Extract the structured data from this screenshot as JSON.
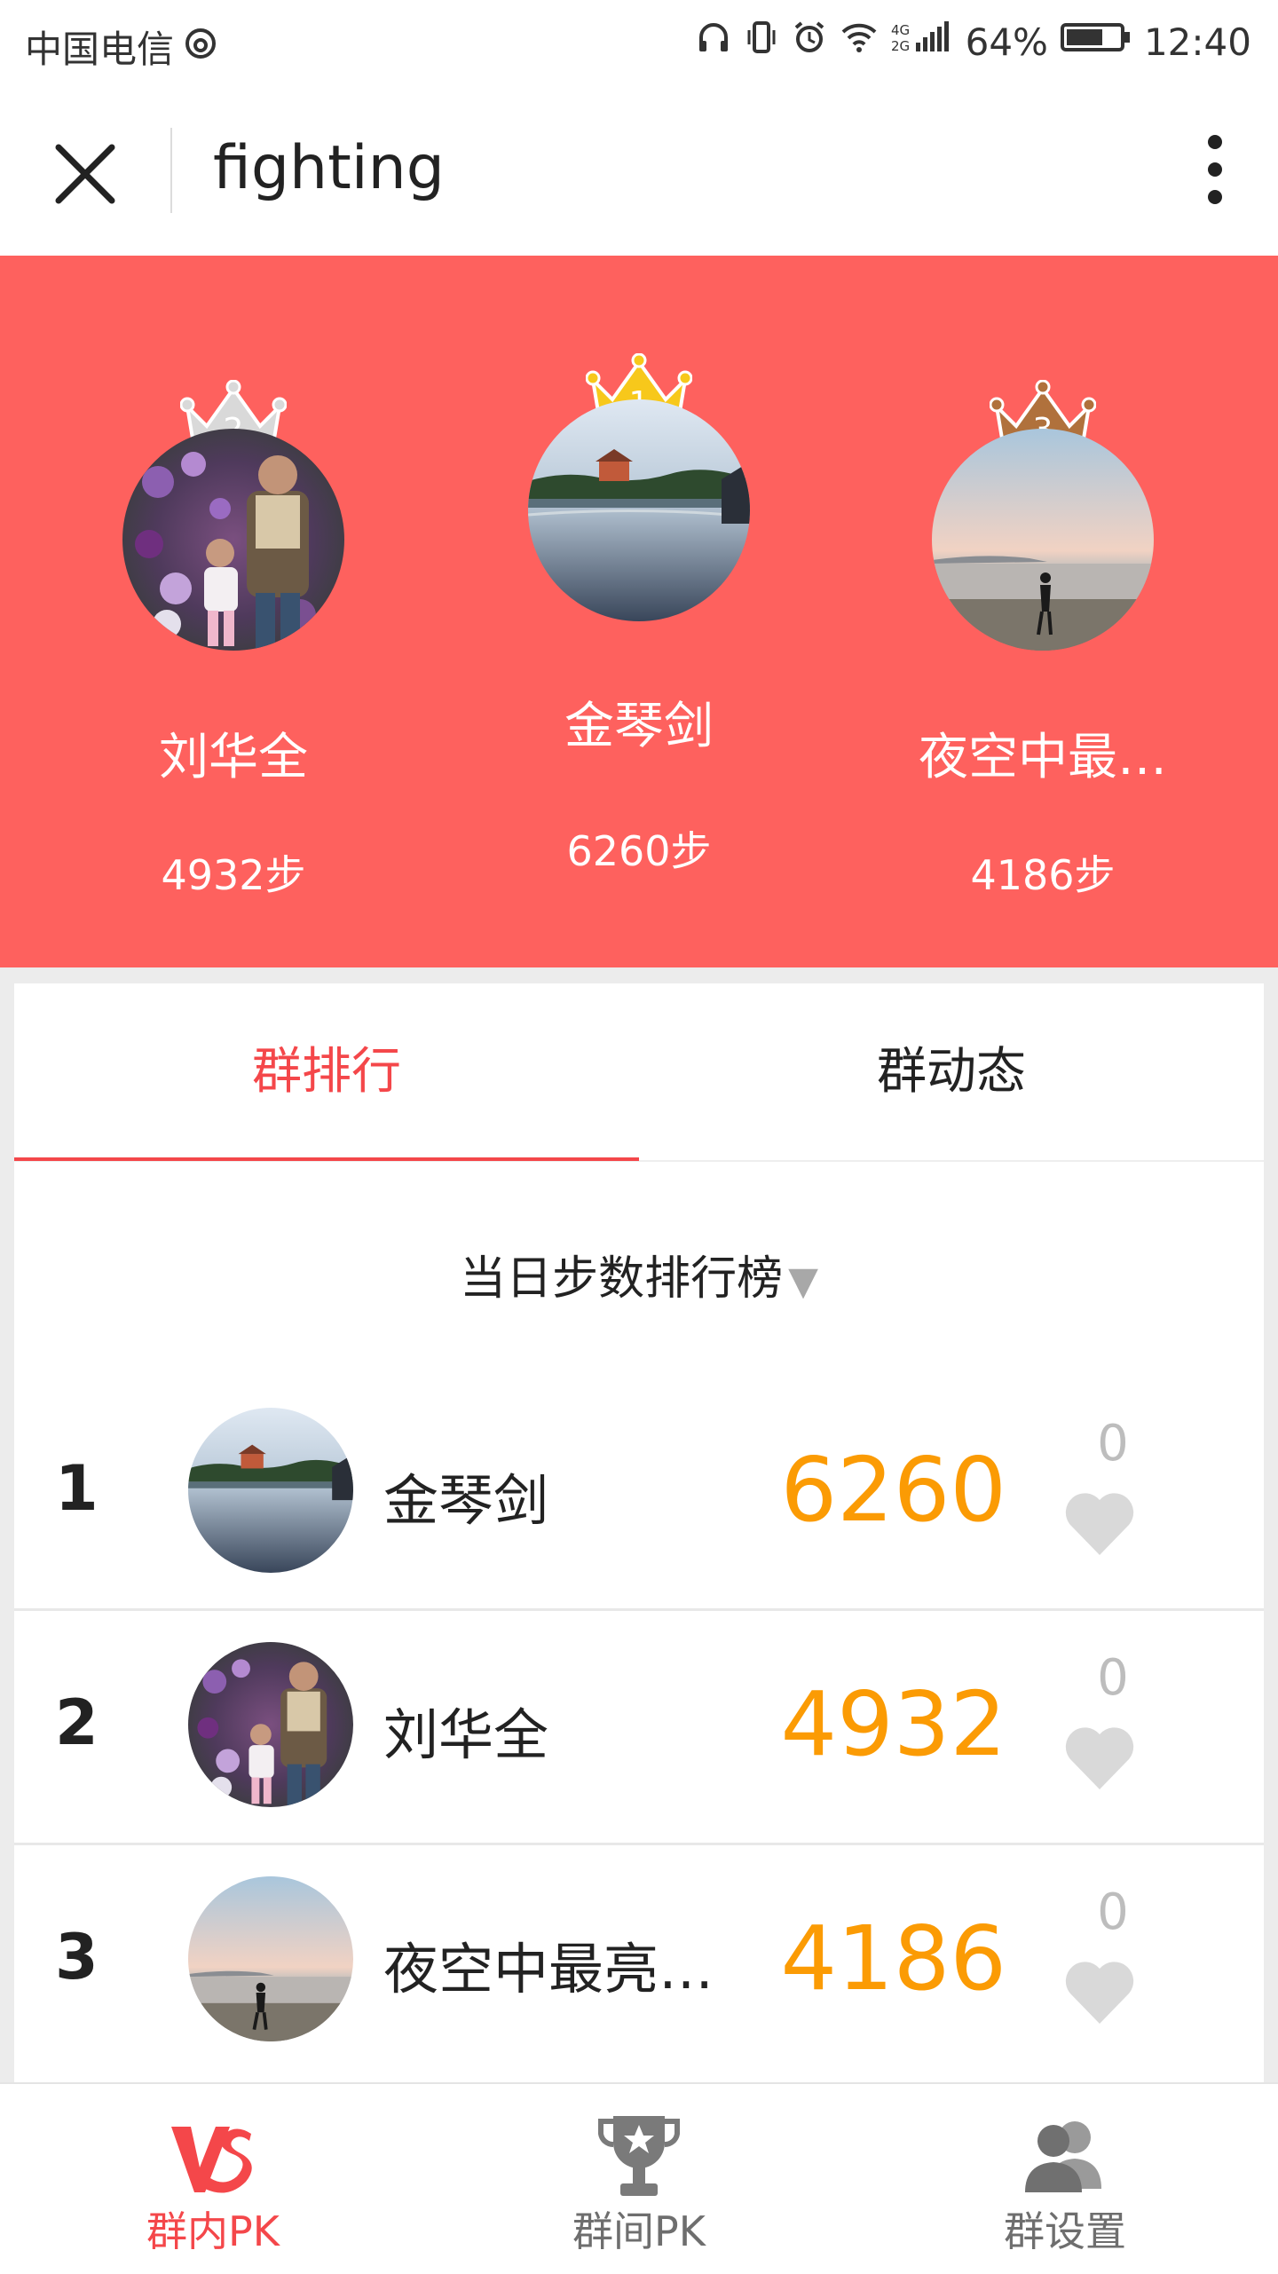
{
  "status_bar": {
    "carrier": "中国电信",
    "battery": "64%",
    "time": "12:40",
    "network": "4G 2G"
  },
  "header": {
    "title": "fighting"
  },
  "podium": {
    "first": {
      "rank": "1",
      "name": "金琴剑",
      "steps": "6260步",
      "crown_color": "#f7c81b"
    },
    "second": {
      "rank": "2",
      "name": "刘华全",
      "steps": "4932步",
      "crown_color": "#d6d6d6"
    },
    "third": {
      "rank": "3",
      "name": "夜空中最…",
      "steps": "4186步",
      "crown_color": "#b0713c"
    }
  },
  "tabs": [
    {
      "label": "群排行",
      "active": true
    },
    {
      "label": "群动态",
      "active": false
    }
  ],
  "board_selector": {
    "label": "当日步数排行榜",
    "arrow": "▼"
  },
  "ranking": [
    {
      "rank": "1",
      "name": "金琴剑",
      "steps": "6260",
      "likes": "0"
    },
    {
      "rank": "2",
      "name": "刘华全",
      "steps": "4932",
      "likes": "0"
    },
    {
      "rank": "3",
      "name": "夜空中最亮…",
      "steps": "4186",
      "likes": "0"
    }
  ],
  "bottom_nav": [
    {
      "label": "群内PK",
      "icon": "vs-icon",
      "active": true
    },
    {
      "label": "群间PK",
      "icon": "trophy-icon",
      "active": false
    },
    {
      "label": "群设置",
      "icon": "users-icon",
      "active": false
    }
  ],
  "colors": {
    "brand_red": "#fe615e",
    "accent_red": "#f4474a",
    "steps_orange": "#fb9b04"
  }
}
